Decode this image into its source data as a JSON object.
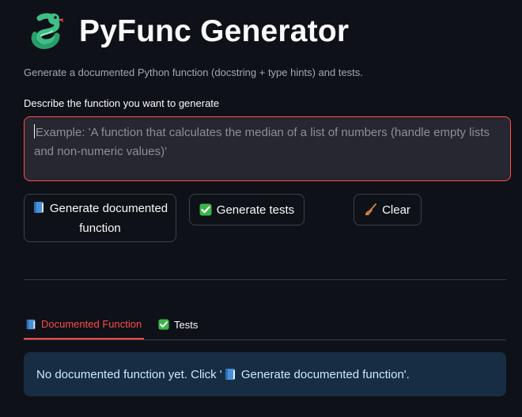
{
  "header": {
    "title": "PyFunc Generator",
    "subtitle": "Generate a documented Python function (docstring + type hints) and tests.",
    "logo_icon": "snake-icon"
  },
  "prompt": {
    "label": "Describe the function you want to generate",
    "placeholder": "Example: 'A function that calculates the median of a list of numbers (handle empty lists and non-numeric values)'",
    "value": ""
  },
  "buttons": {
    "generate_function": {
      "icon": "blue-book-icon",
      "label": "Generate documented function"
    },
    "generate_tests": {
      "icon": "check-mark-icon",
      "label": "Generate tests"
    },
    "clear": {
      "icon": "broom-icon",
      "label": "Clear"
    }
  },
  "tabs": [
    {
      "icon": "blue-book-icon",
      "label": "Documented Function",
      "active": true
    },
    {
      "icon": "check-mark-icon",
      "label": "Tests",
      "active": false
    }
  ],
  "info": {
    "prefix": "No documented function yet. Click '",
    "icon": "blue-book-icon",
    "suffix": " Generate documented function'."
  },
  "colors": {
    "background": "#0e1117",
    "accent": "#ff4b4b",
    "input_bg": "#262730",
    "info_bg": "#172d43",
    "info_text": "#c7ebff"
  }
}
